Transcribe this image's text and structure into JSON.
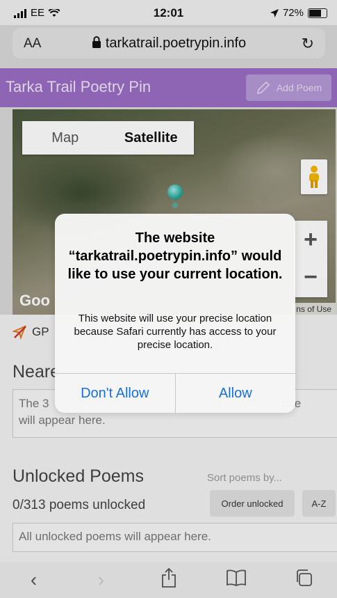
{
  "status_bar": {
    "carrier": "EE",
    "time": "12:01",
    "battery": "72%"
  },
  "browser": {
    "text_size_label": "AA",
    "url": "tarkatrail.poetrypin.info"
  },
  "header": {
    "title": "Tarka Trail Poetry Pin",
    "add_poem_label": "Add Poem"
  },
  "map": {
    "tabs": [
      "Map",
      "Satellite"
    ],
    "active_tab": "Satellite",
    "zoom_in": "+",
    "zoom_out": "−",
    "google_label": "Goo",
    "terms_label": "ns of Use"
  },
  "gps": {
    "label": "GP"
  },
  "nearest": {
    "title": "Neare",
    "placeholder": "The 3                                                                       nce\nwill appear here."
  },
  "unlocked": {
    "title": "Unlocked Poems",
    "sort_label": "Sort poems by...",
    "count": "0/313 poems unlocked",
    "order_button": "Order unlocked",
    "az_button": "A-Z",
    "placeholder": "All unlocked poems will appear here."
  },
  "dialog": {
    "title": "The website “tarkatrail.poetrypin.info” would like to use your current location.",
    "message": "This website will use your precise location because Safari currently has access to your precise location.",
    "deny_label": "Don't Allow",
    "allow_label": "Allow"
  }
}
